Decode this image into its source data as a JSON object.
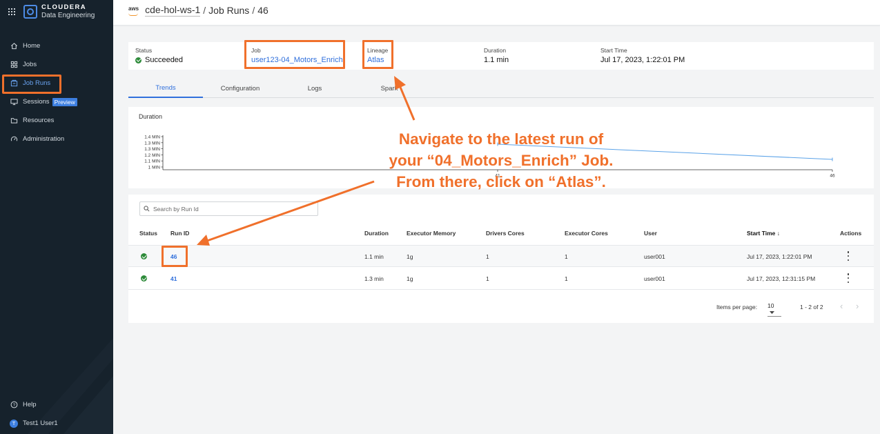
{
  "brand": {
    "name": "CLOUDERA",
    "product": "Data Engineering"
  },
  "sidebar": {
    "items": [
      {
        "label": "Home",
        "icon": "home-icon"
      },
      {
        "label": "Jobs",
        "icon": "jobs-icon"
      },
      {
        "label": "Job Runs",
        "icon": "job-runs-icon",
        "active": true
      },
      {
        "label": "Sessions",
        "icon": "sessions-icon",
        "badge": "Preview"
      },
      {
        "label": "Resources",
        "icon": "resources-icon"
      },
      {
        "label": "Administration",
        "icon": "administration-icon"
      }
    ],
    "help": "Help",
    "user": {
      "initial": "T",
      "name": "Test1 User1"
    }
  },
  "header": {
    "cloud": "aws",
    "workspace": "cde-hol-ws-1",
    "section": "Job Runs",
    "run_id": "46"
  },
  "summary": {
    "status_label": "Status",
    "status_value": "Succeeded",
    "job_label": "Job",
    "job_value": "user123-04_Motors_Enrich",
    "lineage_label": "Lineage",
    "lineage_value": "Atlas",
    "duration_label": "Duration",
    "duration_value": "1.1 min",
    "start_label": "Start Time",
    "start_value": "Jul 17, 2023, 1:22:01 PM"
  },
  "tabs": [
    "Trends",
    "Configuration",
    "Logs",
    "Spark"
  ],
  "trends": {
    "title": "Duration",
    "y_ticks": [
      "1.4 MIN",
      "1.3 MIN",
      "1.3 MIN",
      "1.2 MIN",
      "1.1 MIN",
      "1 MIN"
    ],
    "x_ticks": [
      "41",
      "46"
    ]
  },
  "chart_data": {
    "type": "line",
    "title": "Duration",
    "x": [
      "41",
      "46"
    ],
    "series": [
      {
        "values": [
          1.3,
          1.1
        ]
      }
    ],
    "ylim": [
      1.0,
      1.4
    ],
    "y_ticks": [
      "1.4 MIN",
      "1.3 MIN",
      "1.3 MIN",
      "1.2 MIN",
      "1.1 MIN",
      "1 MIN"
    ],
    "line_color": "#5aa2e8"
  },
  "table": {
    "search_placeholder": "Search by Run Id",
    "columns": [
      "Status",
      "Run ID",
      "Duration",
      "Executor Memory",
      "Drivers Cores",
      "Executor Cores",
      "User",
      "Start Time",
      "Actions"
    ],
    "sort_indicator": "↓",
    "rows": [
      {
        "run_id": "46",
        "duration": "1.1 min",
        "executor_memory": "1g",
        "drivers_cores": "1",
        "executor_cores": "1",
        "user": "user001",
        "start_time": "Jul 17, 2023, 1:22:01 PM"
      },
      {
        "run_id": "41",
        "duration": "1.3 min",
        "executor_memory": "1g",
        "drivers_cores": "1",
        "executor_cores": "1",
        "user": "user001",
        "start_time": "Jul 17, 2023, 12:31:15 PM"
      }
    ],
    "items_per_page_label": "Items per page:",
    "items_per_page": "10",
    "range": "1 - 2 of 2"
  },
  "annotation": {
    "lines": [
      "Navigate to the latest run of",
      "your “04_Motors_Enrich” Job.",
      "From there, click on “Atlas”."
    ],
    "color": "#f0702b"
  }
}
